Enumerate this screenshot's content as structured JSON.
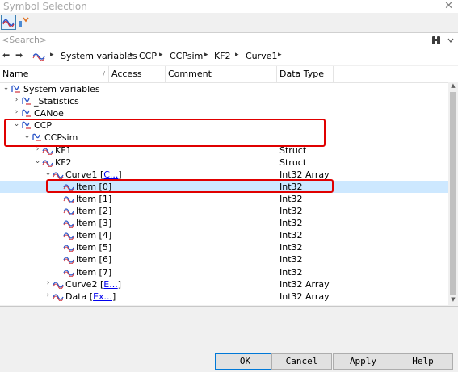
{
  "window": {
    "title": "Symbol Selection",
    "close_glyph": "✕"
  },
  "toolbar": {
    "buttons": [
      {
        "icon": "signal-icon",
        "active": true
      },
      {
        "icon": "filter-icon",
        "active": false
      }
    ]
  },
  "search": {
    "placeholder": "<Search>",
    "tool_icon": "binoculars-icon"
  },
  "navbar": {
    "back_glyph": "⬅",
    "forward_glyph": "➡",
    "breadcrumbs": [
      "System variables",
      "CCP",
      "CCPsim",
      "KF2",
      "Curve1"
    ],
    "separator": "▸"
  },
  "columns": [
    "Name",
    "Access",
    "Comment",
    "Data Type"
  ],
  "rows": [
    {
      "label": "System variables",
      "type": "",
      "expander": "⌄",
      "link": ""
    },
    {
      "label": "_Statistics",
      "type": "",
      "expander": "›",
      "link": ""
    },
    {
      "label": "CANoe",
      "type": "",
      "expander": "›",
      "link": ""
    },
    {
      "label": "CCP",
      "type": "",
      "expander": "⌄",
      "link": ""
    },
    {
      "label": "CCPsim",
      "type": "",
      "expander": "⌄",
      "link": ""
    },
    {
      "label": "KF1",
      "type": "Struct",
      "expander": "›",
      "link": ""
    },
    {
      "label": "KF2",
      "type": "Struct",
      "expander": "⌄",
      "link": ""
    },
    {
      "label": "Curve1",
      "type": "Int32 Array",
      "expander": "⌄",
      "link": "C..."
    },
    {
      "label": "Item [0]",
      "type": "Int32",
      "expander": "",
      "link": ""
    },
    {
      "label": "Item [1]",
      "type": "Int32",
      "expander": "",
      "link": ""
    },
    {
      "label": "Item [2]",
      "type": "Int32",
      "expander": "",
      "link": ""
    },
    {
      "label": "Item [3]",
      "type": "Int32",
      "expander": "",
      "link": ""
    },
    {
      "label": "Item [4]",
      "type": "Int32",
      "expander": "",
      "link": ""
    },
    {
      "label": "Item [5]",
      "type": "Int32",
      "expander": "",
      "link": ""
    },
    {
      "label": "Item [6]",
      "type": "Int32",
      "expander": "",
      "link": ""
    },
    {
      "label": "Item [7]",
      "type": "Int32",
      "expander": "",
      "link": ""
    },
    {
      "label": "Curve2",
      "type": "Int32 Array",
      "expander": "›",
      "link": "E..."
    },
    {
      "label": "Data",
      "type": "Int32 Array",
      "expander": "›",
      "link": "Ex..."
    }
  ],
  "selected_row": "Item [0]",
  "buttons": {
    "ok": "OK",
    "cancel": "Cancel",
    "apply": "Apply",
    "help": "Help"
  },
  "colors": {
    "selection": "#cde8ff",
    "highlight": "#e00000",
    "link": "#0000ee",
    "accent": "#0078d7"
  }
}
